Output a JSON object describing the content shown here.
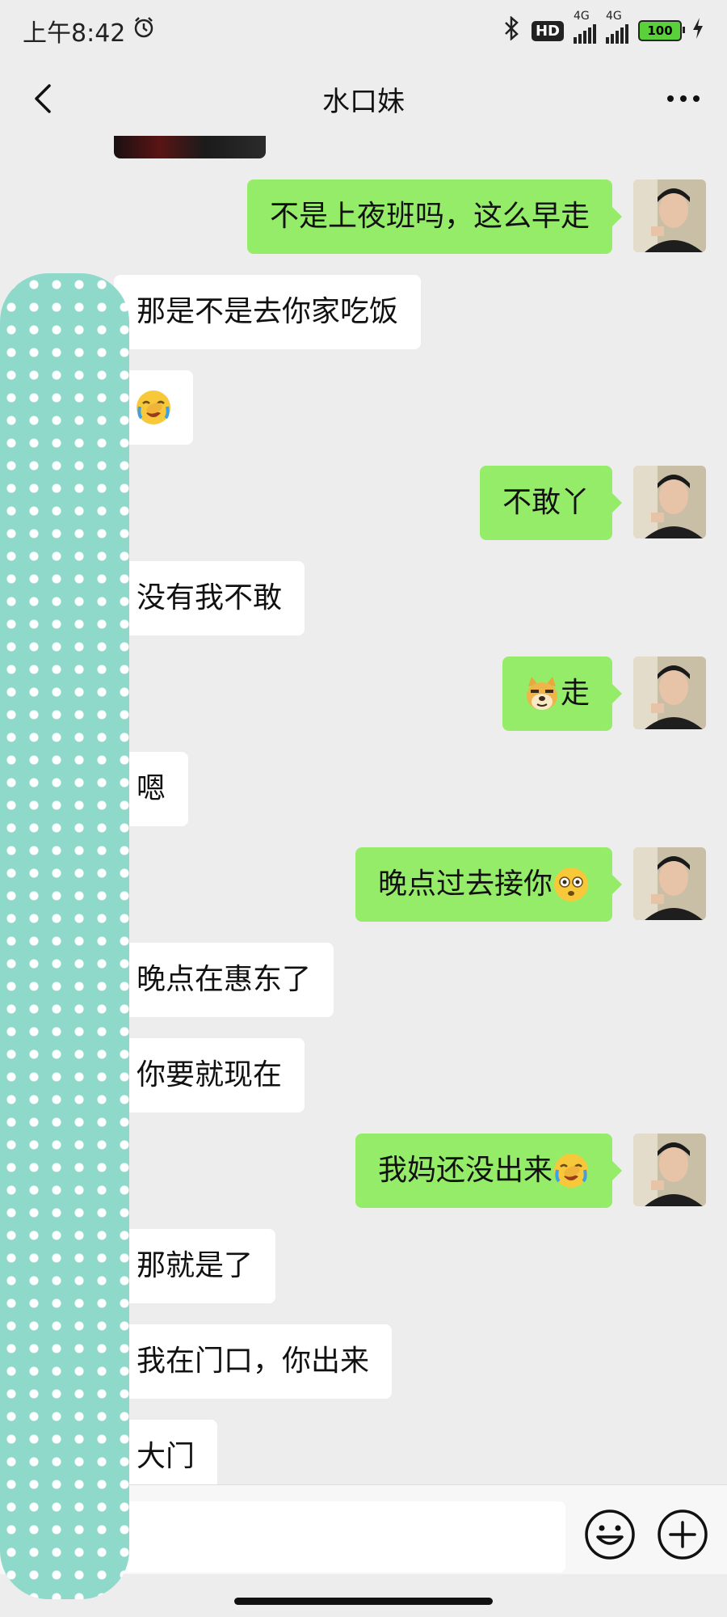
{
  "status_bar": {
    "time": "上午8:42",
    "hd_label": "HD",
    "net_label_1": "4G",
    "net_label_2": "4G",
    "battery": "100"
  },
  "header": {
    "title": "水口妹"
  },
  "messages": [
    {
      "side": "out",
      "text": "不是上夜班吗，这么早走"
    },
    {
      "side": "in",
      "text": "那是不是去你家吃饭"
    },
    {
      "side": "in",
      "emoji": "facepalm-cry"
    },
    {
      "side": "out",
      "text": "不敢丫"
    },
    {
      "side": "in",
      "text": "没有我不敢"
    },
    {
      "side": "out",
      "emoji_prefix": "doge",
      "text": "走"
    },
    {
      "side": "in",
      "text": "嗯"
    },
    {
      "side": "out",
      "text": "晚点过去接你",
      "emoji_suffix": "stunned-face"
    },
    {
      "side": "in",
      "text": "晚点在惠东了"
    },
    {
      "side": "in",
      "text": "你要就现在"
    },
    {
      "side": "out",
      "text": "我妈还没出来",
      "emoji_suffix": "facepalm-cry"
    },
    {
      "side": "in",
      "text": "那就是了"
    },
    {
      "side": "in",
      "text": "我在门口，你出来"
    },
    {
      "side": "in",
      "text": "大门"
    }
  ],
  "input_bar": {
    "placeholder": ""
  },
  "colors": {
    "outgoing_bubble": "#95ec69",
    "incoming_bubble": "#ffffff",
    "background": "#ededed",
    "privacy_mask": "#8fd9cb"
  },
  "icons": [
    "back-arrow-icon",
    "more-dots-icon",
    "alarm-icon",
    "bluetooth-icon",
    "charging-icon",
    "emoji-icon",
    "plus-icon"
  ]
}
